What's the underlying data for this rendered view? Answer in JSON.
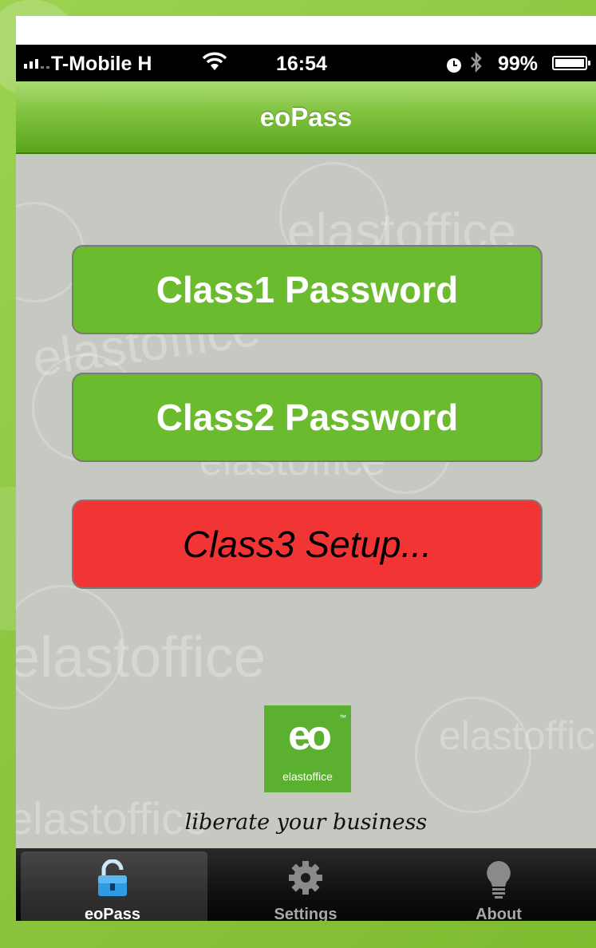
{
  "status_bar": {
    "carrier": "T-Mobile H",
    "time": "16:54",
    "battery_pct": "99%"
  },
  "nav": {
    "title": "eoPass"
  },
  "buttons": {
    "class1": "Class1 Password",
    "class2": "Class2 Password",
    "class3": "Class3 Setup..."
  },
  "logo": {
    "mark": "eo",
    "trademark": "™",
    "brand": "elastoffice"
  },
  "tagline": "liberate your business",
  "tabs": [
    {
      "label": "eoPass",
      "icon": "lock-icon",
      "active": true
    },
    {
      "label": "Settings",
      "icon": "gear-icon",
      "active": false
    },
    {
      "label": "About",
      "icon": "lightbulb-icon",
      "active": false
    }
  ],
  "colors": {
    "nav_green": "#6abb2e",
    "button_green": "#6abb2e",
    "button_red": "#f13535",
    "content_bg": "#c6c8c2"
  }
}
